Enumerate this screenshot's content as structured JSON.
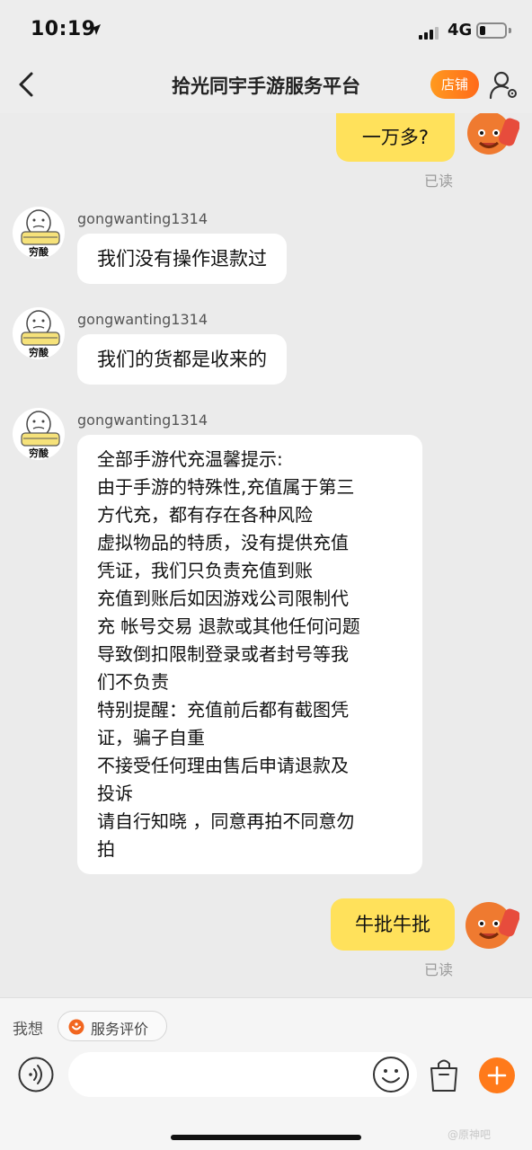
{
  "status_bar": {
    "time": "10:19",
    "network": "4G"
  },
  "nav": {
    "title": "拾光同宇手游服务平台",
    "shop_label": "店铺"
  },
  "messages": {
    "m1": {
      "text": "一万多?",
      "read": "已读"
    },
    "m2": {
      "sender": "gongwanting1314",
      "text": "我们没有操作退款过"
    },
    "m3": {
      "sender": "gongwanting1314",
      "text": "我们的货都是收来的"
    },
    "m4": {
      "sender": "gongwanting1314",
      "lines": [
        "全部手游代充温馨提示:",
        "由于手游的特殊性,充值属于第三",
        "方代充，都有存在各种风险",
        "虚拟物品的特质，没有提供充值",
        "凭证，我们只负责充值到账",
        "充值到账后如因游戏公司限制代",
        "充 帐号交易 退款或其他任何问题",
        "导致倒扣限制登录或者封号等我",
        "们不负责",
        "特别提醒：充值前后都有截图凭",
        "证，骗子自重",
        "不接受任何理由售后申请退款及",
        "投诉",
        "请自行知晓 ，同意再拍不同意勿",
        "拍"
      ]
    },
    "m5": {
      "text": "牛批牛批",
      "read": "已读"
    },
    "avatar_other_caption": "穷酸"
  },
  "bottom": {
    "want_label": "我想",
    "service_chip": "服务评价",
    "input_placeholder": ""
  },
  "watermark": "@原神吧",
  "colors": {
    "accent_orange": "#ff7a1a",
    "my_bubble": "#ffe15b"
  }
}
